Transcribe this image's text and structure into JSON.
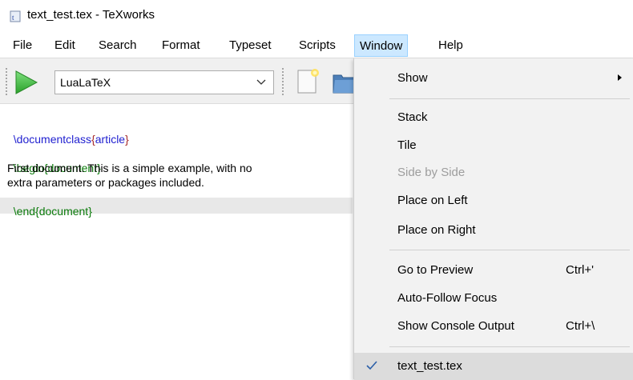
{
  "window": {
    "title": "text_test.tex - TeXworks",
    "app_icon": "texworks-icon"
  },
  "menubar": {
    "items": [
      "File",
      "Edit",
      "Search",
      "Format",
      "Typeset",
      "Scripts",
      "Window",
      "Help"
    ],
    "open_menu": "Window"
  },
  "toolbar": {
    "typeset_engine": "LuaLaTeX",
    "icons": [
      "typeset-play-icon",
      "chevron-down-icon",
      "new-document-icon",
      "open-folder-icon"
    ]
  },
  "editor": {
    "lines": [
      {
        "cmd": "\\documentclass",
        "open": "{",
        "arg": "article",
        "close": "}"
      },
      {
        "text": ""
      },
      {
        "cmd": "\\begin",
        "open": "{",
        "arg": "document",
        "close": "}"
      },
      {
        "text": "First document. This is a simple example, with no"
      },
      {
        "text": "extra parameters or packages included."
      },
      {
        "cmd": "\\end",
        "open": "{",
        "arg": "document",
        "close": "}"
      }
    ],
    "colors": {
      "command_blue": "#1f1fd0",
      "command_green": "#0a7a0a",
      "brace_red": "#a52a2a",
      "current_line": "#e8e8e8"
    }
  },
  "window_menu": {
    "show": {
      "label": "Show",
      "has_submenu": true
    },
    "stack": {
      "label": "Stack"
    },
    "tile": {
      "label": "Tile"
    },
    "side_by_side": {
      "label": "Side by Side",
      "disabled": true
    },
    "place_left": {
      "label": "Place on Left"
    },
    "place_right": {
      "label": "Place on Right"
    },
    "go_to_preview": {
      "label": "Go to Preview",
      "shortcut": "Ctrl+'"
    },
    "auto_follow": {
      "label": "Auto-Follow Focus"
    },
    "show_console": {
      "label": "Show Console Output",
      "shortcut": "Ctrl+\\"
    },
    "open_doc": {
      "label": "text_test.tex",
      "checked": true
    }
  }
}
